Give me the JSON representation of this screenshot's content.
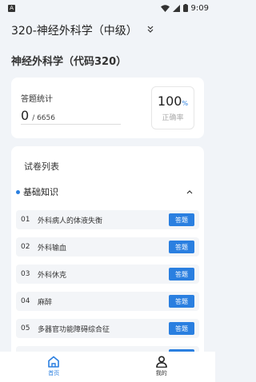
{
  "status_bar": {
    "time": "9:09",
    "left_badge": "A"
  },
  "header": {
    "title": "320-神经外科学（中级）"
  },
  "subject": {
    "title": "神经外科学（代码320）"
  },
  "stats": {
    "label": "答题统计",
    "count": "0",
    "total": "/ 6656",
    "rate_value": "100",
    "rate_unit": "%",
    "rate_label": "正确率"
  },
  "list": {
    "title": "试卷列表",
    "section": {
      "name": "基础知识",
      "expanded": true
    },
    "items": [
      {
        "num": "01",
        "name": "外科病人的体液失衡",
        "action": "答题"
      },
      {
        "num": "02",
        "name": "外科输血",
        "action": "答题"
      },
      {
        "num": "03",
        "name": "外科休克",
        "action": "答题"
      },
      {
        "num": "04",
        "name": "麻醉",
        "action": "答题"
      },
      {
        "num": "05",
        "name": "多器官功能障碍综合征",
        "action": "答题"
      }
    ]
  },
  "tabbar": {
    "tabs": [
      {
        "label": "首页",
        "icon": "home-icon",
        "active": true
      },
      {
        "label": "我的",
        "icon": "user-icon",
        "active": false
      }
    ]
  },
  "colors": {
    "accent": "#2a7fe0",
    "background": "#f1f4f8"
  }
}
